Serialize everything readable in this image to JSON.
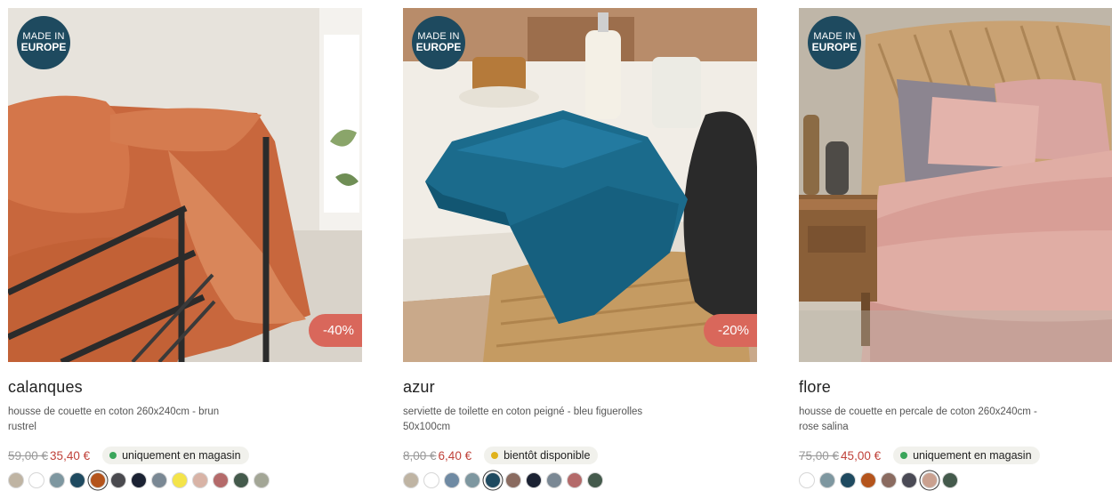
{
  "products": [
    {
      "badge": {
        "line1": "MADE IN",
        "line2": "EUROPE"
      },
      "discount": "-40%",
      "name": "calanques",
      "description": "housse de couette en coton 260x240cm - brun rustrel",
      "old_price": "59,00 €",
      "new_price": "35,40 €",
      "availability": "uniquement en magasin",
      "availability_color": "#3aa55a",
      "swatches": [
        "#bfb4a3",
        "#ffffff",
        "#7e97a0",
        "#1f4a60",
        "#b4541c",
        "#4a4a4f",
        "#1b2233",
        "#7a8894",
        "#f4e44a",
        "#d8b3a6",
        "#b46a6a",
        "#445a4c",
        "#a3a696"
      ],
      "selected_swatch": 4
    },
    {
      "badge": {
        "line1": "MADE IN",
        "line2": "EUROPE"
      },
      "discount": "-20%",
      "name": "azur",
      "description": "serviette de toilette en coton peigné - bleu figuerolles 50x100cm",
      "old_price": "8,00 €",
      "new_price": "6,40 €",
      "availability": "bientôt disponible",
      "availability_color": "#e0b21c",
      "swatches": [
        "#bfb4a3",
        "#ffffff",
        "#6f8aa3",
        "#7e97a0",
        "#1f4a60",
        "#8a6b60",
        "#1b2233",
        "#7a8894",
        "#b46a6a",
        "#445a4c"
      ],
      "selected_swatch": 4
    },
    {
      "badge": {
        "line1": "MADE IN",
        "line2": "EUROPE"
      },
      "discount": "-",
      "name": "flore",
      "description": "housse de couette en percale de coton 260x240cm - rose salina",
      "old_price": "75,00 €",
      "new_price": "45,00 €",
      "availability": "uniquement en magasin",
      "availability_color": "#3aa55a",
      "swatches": [
        "#ffffff",
        "#7e97a0",
        "#1f4a60",
        "#b4541c",
        "#8a6b60",
        "#4a4a55",
        "#caa190",
        "#445a4c"
      ],
      "selected_swatch": 6
    }
  ]
}
